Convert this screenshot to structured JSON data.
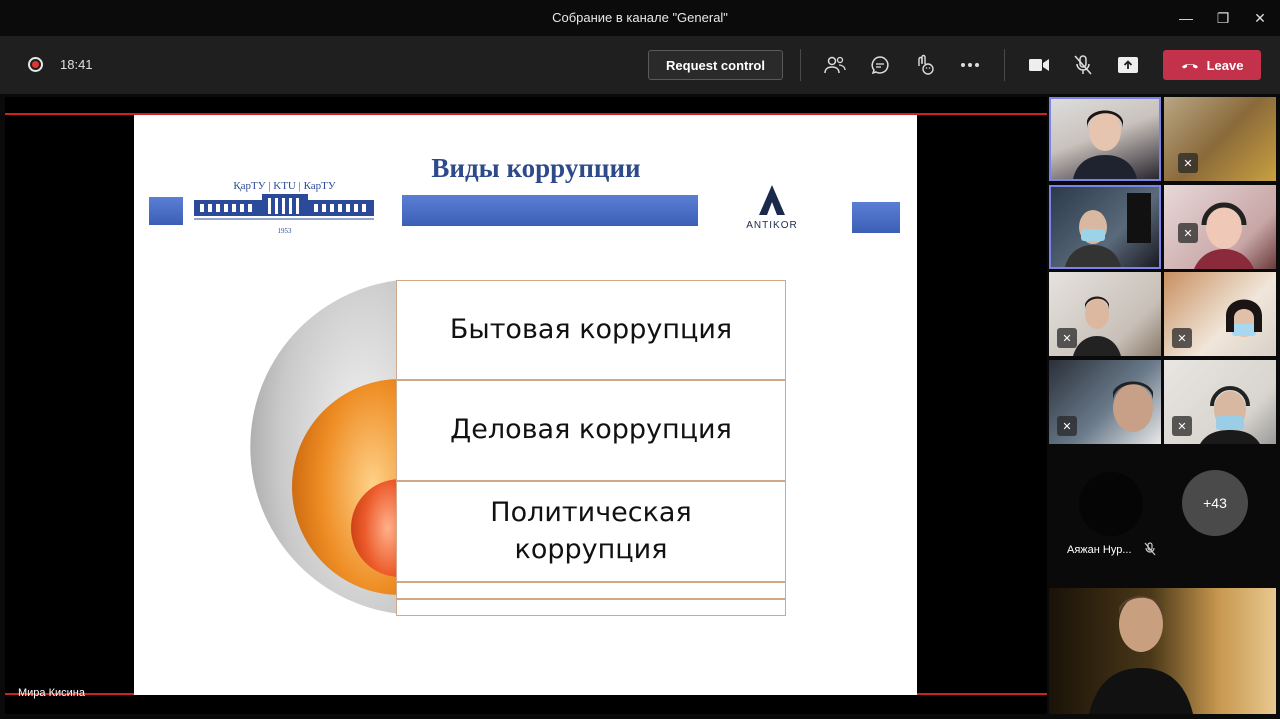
{
  "window": {
    "title": "Собрание в канале \"General\"",
    "min": "—",
    "max": "❐",
    "close": "✕"
  },
  "toolbar": {
    "time": "18:41",
    "request_control": "Request control",
    "leave": "Leave",
    "icons": [
      "people-icon",
      "chat-icon",
      "reactions-icon",
      "more-icon",
      "camera-icon",
      "mic-muted-icon",
      "share-icon"
    ]
  },
  "slide": {
    "title": "Виды коррупции",
    "logo_left_text": "ҚарТУ | KTU | КарТУ",
    "logo_left_year": "1953",
    "logo_right_text": "ANTIKOR",
    "items": [
      "Бытовая коррупция",
      "Деловая коррупция",
      "Политическая коррупция"
    ],
    "item3_line1": "Политическая",
    "item3_line2": "коррупция"
  },
  "presenter_name": "Мира Кисина",
  "participants": {
    "named": "Аяжан Нур...",
    "overflow": "+43"
  },
  "colors": {
    "accent_red": "#c4314b",
    "slide_title": "#2f4a8a",
    "active_tile": "#7b83eb"
  }
}
